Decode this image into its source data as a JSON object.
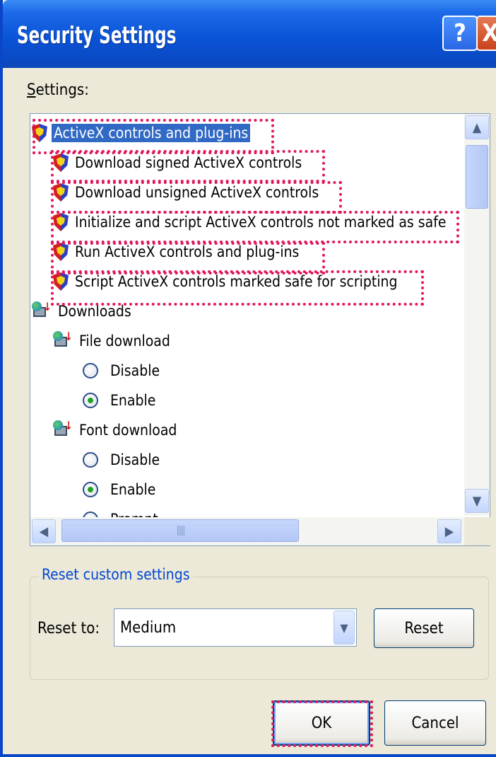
{
  "window": {
    "title": "Security Settings",
    "help_symbol": "?",
    "close_symbol": "X"
  },
  "settings_label": "Settings:",
  "tree": {
    "items": [
      {
        "label": "ActiveX controls and plug-ins",
        "icon": "shield-icon",
        "level": 0,
        "selected": true,
        "highlighted": true
      },
      {
        "label": "Download signed ActiveX controls",
        "icon": "shield-icon",
        "level": 1,
        "highlighted": true
      },
      {
        "label": "Download unsigned ActiveX controls",
        "icon": "shield-icon",
        "level": 1,
        "highlighted": true
      },
      {
        "label": "Initialize and script ActiveX controls not marked as safe",
        "icon": "shield-icon",
        "level": 1,
        "highlighted": true
      },
      {
        "label": "Run ActiveX controls and plug-ins",
        "icon": "shield-icon",
        "level": 1,
        "highlighted": true
      },
      {
        "label": "Script ActiveX controls marked safe for scripting",
        "icon": "shield-icon",
        "level": 1,
        "highlighted": true
      },
      {
        "label": "Downloads",
        "icon": "download-icon",
        "level": 0
      },
      {
        "label": "File download",
        "icon": "download-icon",
        "level": 1
      },
      {
        "label": "Disable",
        "icon": "radio",
        "level": 2,
        "checked": false
      },
      {
        "label": "Enable",
        "icon": "radio",
        "level": 2,
        "checked": true
      },
      {
        "label": "Font download",
        "icon": "download-icon",
        "level": 1
      },
      {
        "label": "Disable",
        "icon": "radio",
        "level": 2,
        "checked": false
      },
      {
        "label": "Enable",
        "icon": "radio",
        "level": 2,
        "checked": true
      },
      {
        "label": "Prompt",
        "icon": "radio",
        "level": 2,
        "checked": false
      }
    ]
  },
  "reset_group": {
    "title": "Reset custom settings",
    "reset_to_label": "Reset to:",
    "combo_value": "Medium",
    "reset_button": "Reset"
  },
  "buttons": {
    "ok": "OK",
    "cancel": "Cancel"
  },
  "colors": {
    "highlight_dotted": "#e01760",
    "titlebar": "#0a54d8",
    "selection": "#316ac5"
  }
}
